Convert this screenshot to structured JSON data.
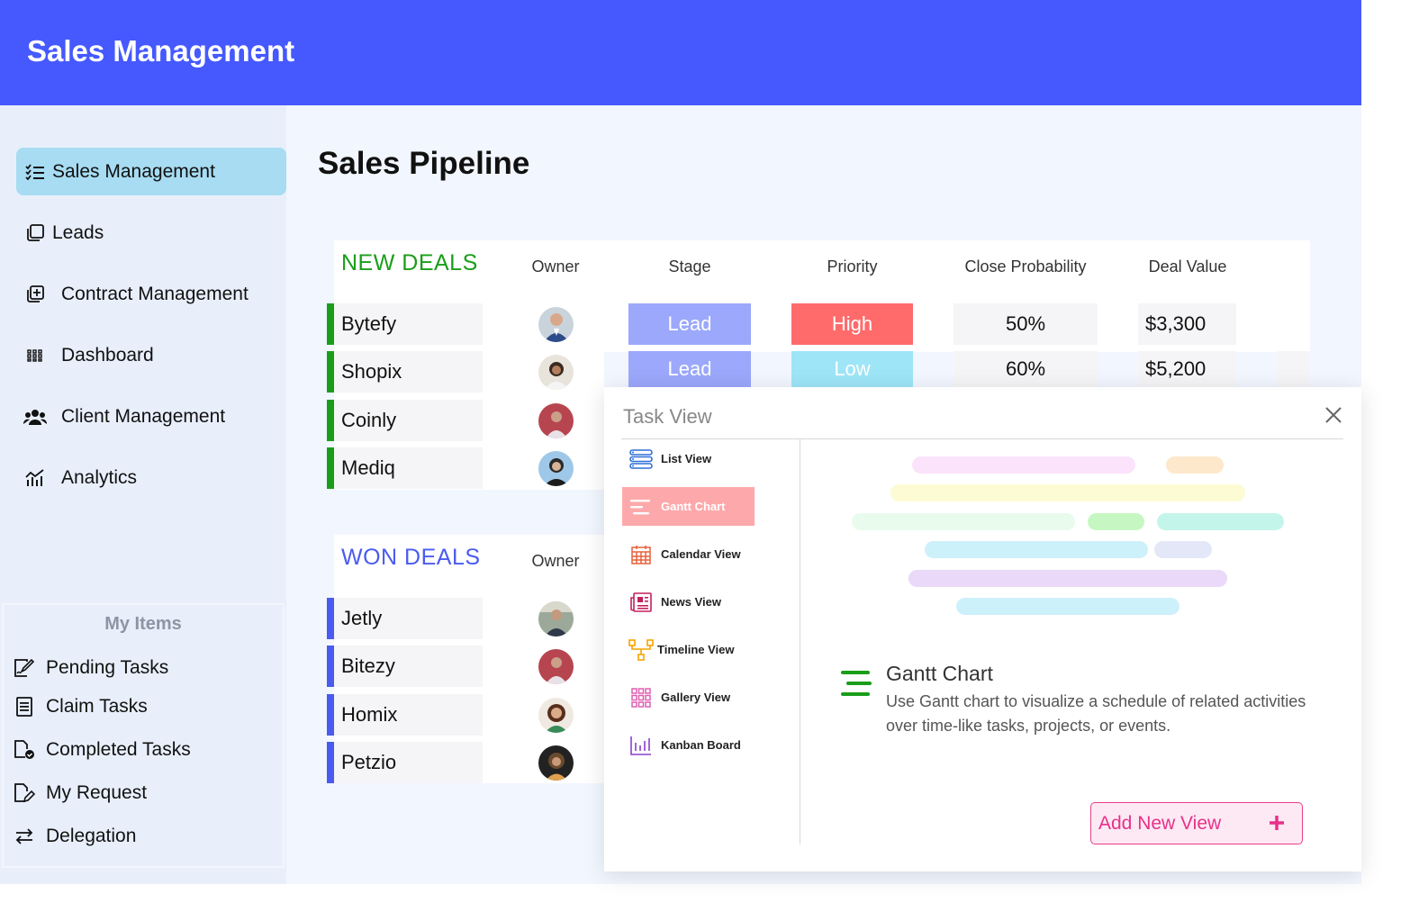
{
  "app": {
    "title": "Sales Management"
  },
  "sidebar": {
    "items": [
      {
        "label": "Sales Management",
        "icon": "checklist-icon",
        "active": true
      },
      {
        "label": "Leads",
        "icon": "copy-icon"
      },
      {
        "label": "Contract Management",
        "icon": "add-document-icon"
      },
      {
        "label": "Dashboard",
        "icon": "grid-dots-icon"
      },
      {
        "label": "Client Management",
        "icon": "users-icon"
      },
      {
        "label": "Analytics",
        "icon": "analytics-icon"
      }
    ]
  },
  "my_items": {
    "heading": "My Items",
    "items": [
      {
        "label": "Pending Tasks",
        "icon": "edit-document-icon"
      },
      {
        "label": "Claim Tasks",
        "icon": "list-document-icon"
      },
      {
        "label": "Completed Tasks",
        "icon": "checked-document-icon"
      },
      {
        "label": "My Request",
        "icon": "request-document-icon"
      },
      {
        "label": "Delegation",
        "icon": "swap-arrows-icon"
      }
    ]
  },
  "page": {
    "title": "Sales Pipeline"
  },
  "new_deals": {
    "title": "NEW DEALS",
    "color": "#1a9e1a",
    "columns": {
      "owner": "Owner",
      "stage": "Stage",
      "priority": "Priority",
      "probability": "Close Probability",
      "value": "Deal Value"
    },
    "rows": [
      {
        "name": "Bytefy",
        "stage": "Lead",
        "priority": "High",
        "probability": "50%",
        "value": "$3,300"
      },
      {
        "name": "Shopix",
        "stage": "Lead",
        "priority": "Low",
        "probability": "60%",
        "value": "$5,200"
      },
      {
        "name": "Coinly"
      },
      {
        "name": "Mediq"
      }
    ]
  },
  "won_deals": {
    "title": "WON DEALS",
    "color": "#4a5bf0",
    "columns": {
      "owner": "Owner"
    },
    "rows": [
      {
        "name": "Jetly"
      },
      {
        "name": "Bitezy"
      },
      {
        "name": "Homix"
      },
      {
        "name": "Petzio"
      }
    ]
  },
  "colors": {
    "header": "#4559fe",
    "stage_lead": "#9ba8fb",
    "priority_high": "#ff6b6b",
    "priority_low": "#9ee5f8",
    "accent_pink": "#e8308a"
  },
  "task_view": {
    "title": "Task View",
    "views": [
      {
        "label": "List View",
        "icon": "list-view-icon"
      },
      {
        "label": "Gantt Chart",
        "icon": "gantt-icon",
        "active": true
      },
      {
        "label": "Calendar View",
        "icon": "calendar-icon"
      },
      {
        "label": "News View",
        "icon": "news-icon"
      },
      {
        "label": "Timeline View",
        "icon": "timeline-icon"
      },
      {
        "label": "Gallery View",
        "icon": "gallery-icon"
      },
      {
        "label": "Kanban Board",
        "icon": "kanban-icon"
      }
    ],
    "detail": {
      "title": "Gantt Chart",
      "description": "Use Gantt chart to visualize a schedule of related activities over time-like tasks, projects, or events."
    },
    "add_button": "Add New View"
  }
}
